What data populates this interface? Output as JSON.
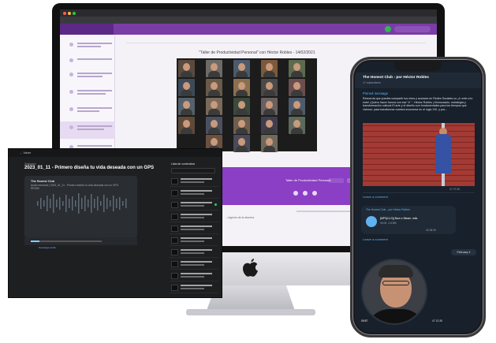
{
  "imac": {
    "session_title": "\"Taller de Productividad Personal\" con Héctor Robles - 14/02/2021",
    "player_title": "Taller de Productividad Personal",
    "footer_note": "...ingenio de la alumna"
  },
  "dark_player": {
    "back_label": "← Volver",
    "small_label": "Grabación",
    "episode_title": "2023_01_11 - Primero diseña tu vida deseada con un GPS",
    "card_title": "The Honest Club",
    "card_sub": "Audio memoria | 2023_01_11 - Primero diseña tu vida deseada con un GPS",
    "card_sub2": "REDIM",
    "list_header": "Lista de contenidos",
    "bottom_link": "Descargar audio"
  },
  "phone": {
    "channel_title": "The Honest Club - por Héctor Robles",
    "channel_sub": "17 subscribers",
    "pinned_label": "Pinned message",
    "pinned_text": "Recuerda que puedes compartir tus retos y avances en Redes Sociales co ¿Ir ente a tu ente! ¡Quiero hacer fuerza con ese \"# \" : Héctor Robles | #Innovación, estrategia y transformación cultural El arte y el diseño son fundamentales para los tiempos que vivimos: para transformar nuestra economía en el siglo XXI, y por...",
    "photo_meta": "37 07:28",
    "comment_label": "Leave a comment",
    "audio_channel": "The Honest Club - por Héctor Robles",
    "audio_title": "[MP3(14.0)] Barn e Bleam..mila",
    "audio_size": "00:00, 2.8 MB",
    "audio_meta": "40 08:39",
    "date_chip": "February 4",
    "video_time": "00:57",
    "video_views": "47 12:35"
  }
}
